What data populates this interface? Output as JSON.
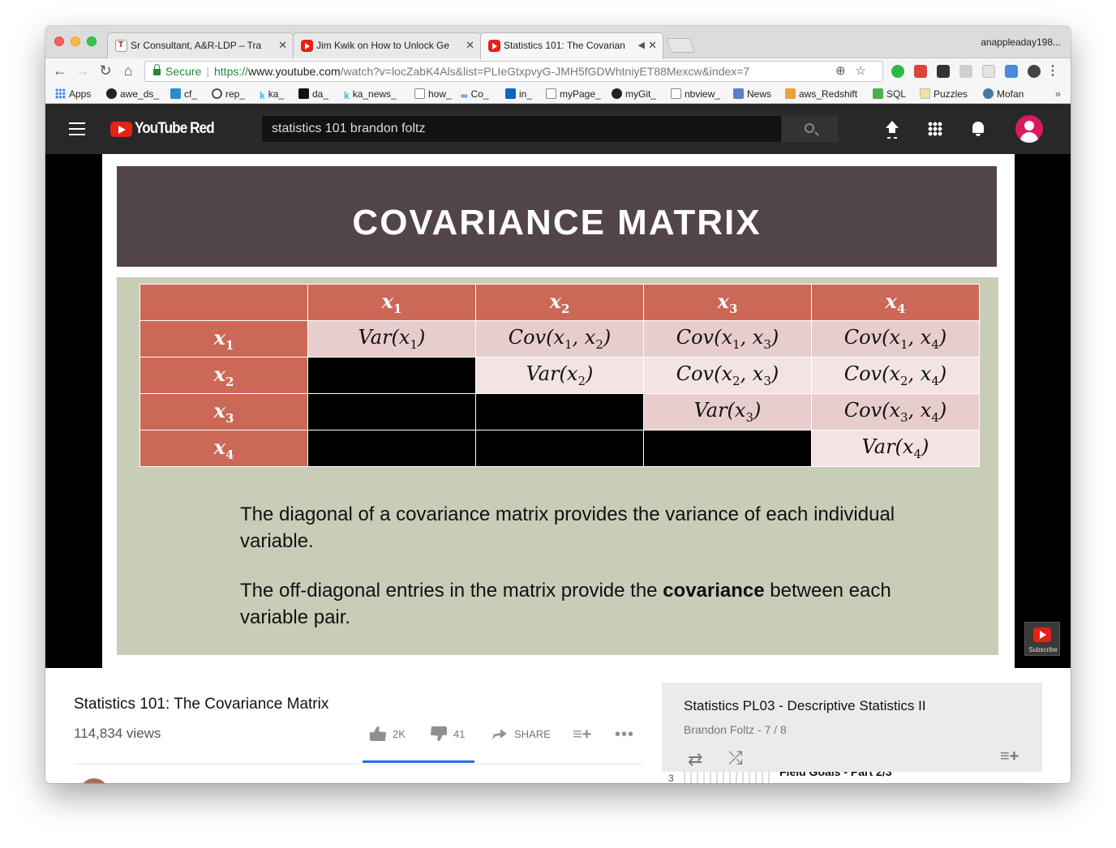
{
  "browser": {
    "tabs": [
      {
        "title": "Sr Consultant, A&R-LDP – Tra",
        "icon": "doc-icon"
      },
      {
        "title": "Jim Kwik on How to Unlock Ge",
        "icon": "youtube-icon"
      },
      {
        "title": "Statistics 101: The Covarian",
        "icon": "youtube-icon",
        "active": true
      }
    ],
    "close_glyph": "✕",
    "profile": "anappleaday198...",
    "omnibox": {
      "secure": "Secure",
      "proto": "https://",
      "host": "www.youtube.com",
      "path": "/watch?v=locZabK4Als&list=PLIeGtxpvyG-JMH5fGDWhtniyET88Mexcw&index=7"
    },
    "bookmarks": [
      "Apps",
      "awe_ds_",
      "cf_",
      "rep_",
      "ka_",
      "da_",
      "ka_news_",
      "how_",
      "Co_",
      "in_",
      "myPage_",
      "myGit_",
      "nbview_",
      "News",
      "aws_Redshift",
      "SQL",
      "Puzzles",
      "Mofan"
    ],
    "bookmarks_more": "»"
  },
  "youtube": {
    "logo": "YouTube Red",
    "search_query": "statistics 101 brandon foltz"
  },
  "slide": {
    "title": "COVARIANCE MATRIX",
    "matrix": {
      "headers": [
        "x",
        "x",
        "x",
        "x"
      ],
      "header_subs": [
        "1",
        "2",
        "3",
        "4"
      ],
      "rows": [
        {
          "label": "x",
          "sub": "1",
          "cells": [
            [
              "Var(x",
              "1",
              ")"
            ],
            [
              "Cov(x",
              "1",
              ", x",
              "2",
              ")"
            ],
            [
              "Cov(x",
              "1",
              ", x",
              "3",
              ")"
            ],
            [
              "Cov(x",
              "1",
              ", x",
              "4",
              ")"
            ]
          ]
        },
        {
          "label": "x",
          "sub": "2",
          "cells": [
            [
              "",
              "",
              ""
            ],
            [
              "Var(x",
              "2",
              ")"
            ],
            [
              "Cov(x",
              "2",
              ", x",
              "3",
              ")"
            ],
            [
              "Cov(x",
              "2",
              ", x",
              "4",
              ")"
            ]
          ]
        },
        {
          "label": "x",
          "sub": "3",
          "cells": [
            [
              "",
              "",
              ""
            ],
            [
              "",
              "",
              ""
            ],
            [
              "Var(x",
              "3",
              ")"
            ],
            [
              "Cov(x",
              "3",
              ", x",
              "4",
              ")"
            ]
          ]
        },
        {
          "label": "x",
          "sub": "4",
          "cells": [
            [
              "",
              "",
              ""
            ],
            [
              "",
              "",
              ""
            ],
            [
              "",
              "",
              ""
            ],
            [
              "Var(x",
              "4",
              ")"
            ]
          ]
        }
      ]
    },
    "para1": "The diagonal of a covariance matrix provides the variance of each individual variable.",
    "para2_pre": "The off-diagonal entries in the matrix provide the ",
    "para2_bold": "covariance",
    "para2_post": " between each variable pair.",
    "watermark_label": "Subscribe"
  },
  "video": {
    "title": "Statistics 101: The Covariance Matrix",
    "views": "114,834 views",
    "likes": "2K",
    "dislikes": "41",
    "share": "SHARE",
    "more": "•••"
  },
  "playlist": {
    "title": "Statistics PL03 - Descriptive Statistics II",
    "meta": "Brandon Foltz - 7 / 8",
    "next_index": "3",
    "next_title": "Field Goals - Part 2/3"
  }
}
